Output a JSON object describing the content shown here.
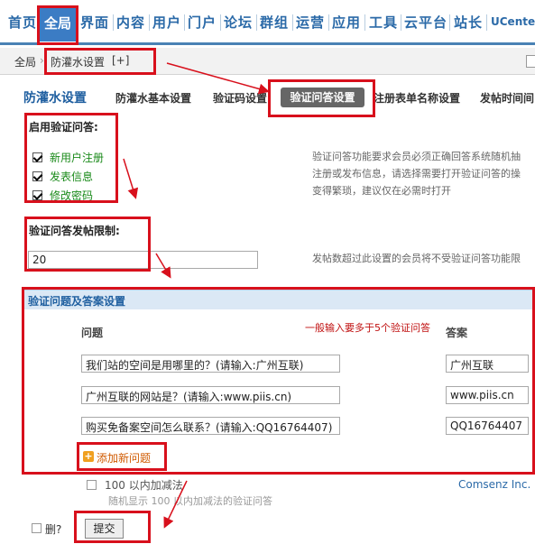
{
  "nav": {
    "items": [
      "首页",
      "全局",
      "界面",
      "内容",
      "用户",
      "门户",
      "论坛",
      "群组",
      "运营",
      "应用",
      "工具",
      "云平台",
      "站长",
      "UCenter"
    ],
    "active_index": 1
  },
  "breadcrumb": {
    "root": "全局",
    "current": "防灌水设置",
    "add": "[+]"
  },
  "tabs": {
    "title": "防灌水设置",
    "items": [
      "防灌水基本设置",
      "验证码设置",
      "验证问答设置",
      "注册表单名称设置",
      "发帖时间间"
    ],
    "active": "验证问答设置"
  },
  "enable_qa": {
    "label": "启用验证问答:",
    "options": [
      {
        "label": "新用户注册",
        "checked": true
      },
      {
        "label": "发表信息",
        "checked": true
      },
      {
        "label": "修改密码",
        "checked": true
      }
    ],
    "tip_lines": [
      "验证问答功能要求会员必须正确回答系统随机抽",
      "注册或发布信息，请选择需要打开验证问答的操",
      "变得繁琐，建议仅在必需时打开"
    ]
  },
  "limit": {
    "label": "验证问答发帖限制:",
    "value": "20",
    "tip": "发帖数超过此设置的会员将不受验证问答功能限"
  },
  "qa_section": {
    "title": "验证问题及答案设置",
    "col_question": "问题",
    "col_answer": "答案",
    "note": "一般输入要多于5个验证问答",
    "rows": [
      {
        "q": "我们站的空间是用哪里的？(请输入:广州互联)",
        "a": "广州互联"
      },
      {
        "q": "广州互联的网站是？(请输入:www.piis.cn)",
        "a": "www.piis.cn"
      },
      {
        "q": "购买免备案空间怎么联系？(请输入:QQ16764407)",
        "a": "QQ16764407"
      }
    ],
    "add_label": "添加新问题"
  },
  "math_qa": {
    "label": "100 以内加减法",
    "sub": "随机显示  100 以内加减法的验证问答",
    "author": "Comsenz Inc."
  },
  "footer": {
    "delete_label": "删?",
    "submit_label": "提交"
  },
  "accent": "#d8101c"
}
